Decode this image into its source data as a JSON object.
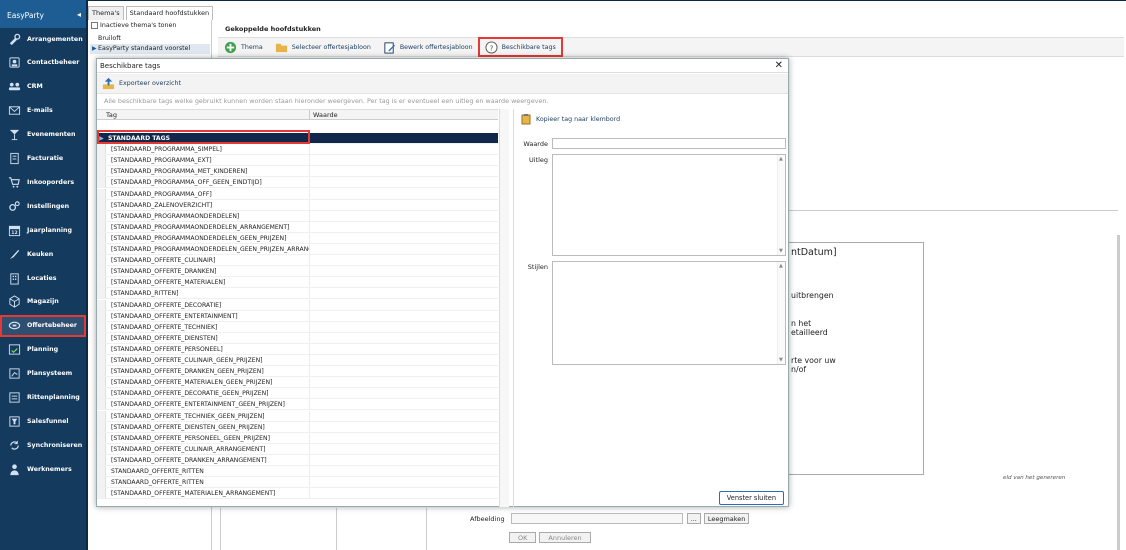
{
  "sidebar": {
    "brand": "EasyParty",
    "collapse_icon": "◂",
    "items": [
      {
        "label": "Arrangementen",
        "icon": "tools-icon"
      },
      {
        "label": "Contactbeheer",
        "icon": "contacts-icon"
      },
      {
        "label": "CRM",
        "icon": "crm-icon"
      },
      {
        "label": "E-mails",
        "icon": "mail-icon"
      },
      {
        "label": "Evenementen",
        "icon": "cocktail-icon"
      },
      {
        "label": "Facturatie",
        "icon": "invoice-icon"
      },
      {
        "label": "Inkooporders",
        "icon": "cart-icon"
      },
      {
        "label": "Instellingen",
        "icon": "gears-icon"
      },
      {
        "label": "Jaarplanning",
        "icon": "calendar-icon"
      },
      {
        "label": "Keuken",
        "icon": "knife-icon"
      },
      {
        "label": "Locaties",
        "icon": "building-icon"
      },
      {
        "label": "Magazijn",
        "icon": "box-icon"
      },
      {
        "label": "Offertebeheer",
        "icon": "quote-icon"
      },
      {
        "label": "Planning",
        "icon": "planning-icon"
      },
      {
        "label": "Plansysteem",
        "icon": "plansystem-icon"
      },
      {
        "label": "Rittenplanning",
        "icon": "routes-icon"
      },
      {
        "label": "Salesfunnel",
        "icon": "funnel-icon"
      },
      {
        "label": "Synchroniseren",
        "icon": "sync-icon"
      },
      {
        "label": "Werknemers",
        "icon": "person-icon"
      }
    ]
  },
  "app": {
    "tabs": [
      "Thema's",
      "Standaard hoofdstukken"
    ],
    "inactive_themes_label": "Inactieve thema's tonen",
    "themes": [
      "Bruiloft",
      "EasyParty standaard voorstel"
    ],
    "linked_chapters_title": "Gekoppelde hoofdstukken",
    "toolbar": {
      "theme": "Thema",
      "select_template": "Selecteer offertesjabloon",
      "edit_template": "Bewerk offertesjabloon",
      "available_tags": "Beschikbare tags"
    },
    "doc_snippets": [
      "ntDatum]",
      "uitbrengen",
      "n het",
      "etailleerd",
      "rte voor uw",
      "n/of"
    ],
    "doc_caption": "eld van het genereren",
    "image_label": "Afbeelding",
    "browse_button": "...",
    "clear_button": "Leegmaken",
    "ok_button": "OK",
    "cancel_button": "Annuleren"
  },
  "dialog": {
    "title": "Beschikbare tags",
    "close": "✕",
    "export_label": "Exporteer overzicht",
    "info_text": "Alle beschikbare tags welke gebruikt kunnen worden staan hieronder weergeven. Per tag is er eventueel een uitleg en waarde weergeven.",
    "columns": [
      "Tag",
      "Waarde"
    ],
    "group_label": "STANDAARD TAGS",
    "tags": [
      "[STANDAARD_PROGRAMMA_SIMPEL]",
      "[STANDAARD_PROGRAMMA_EXT]",
      "[STANDAARD_PROGRAMMA_MET_KINDEREN]",
      "[STANDAARD_PROGRAMMA_OFF_GEEN_EINDTIJD]",
      "[STANDAARD_PROGRAMMA_OFF]",
      "[STANDAARD_ZALENOVERZICHT]",
      "[STANDAARD_PROGRAMMAONDERDELEN]",
      "[STANDAARD_PROGRAMMAONDERDELEN_ARRANGEMENT]",
      "[STANDAARD_PROGRAMMAONDERDELEN_GEEN_PRIJZEN]",
      "[STANDAARD_PROGRAMMAONDERDELEN_GEEN_PRIJZEN_ARRANG",
      "[STANDAARD_OFFERTE_CULINAIR]",
      "[STANDAARD_OFFERTE_DRANKEN]",
      "[STANDAARD_OFFERTE_MATERIALEN]",
      "[STANDAARD_RITTEN]",
      "[STANDAARD_OFFERTE_DECORATIE]",
      "[STANDAARD_OFFERTE_ENTERTAINMENT]",
      "[STANDAARD_OFFERTE_TECHNIEK]",
      "[STANDAARD_OFFERTE_DIENSTEN]",
      "[STANDAARD_OFFERTE_PERSONEEL]",
      "[STANDAARD_OFFERTE_CULINAIR_GEEN_PRIJZEN]",
      "[STANDAARD_OFFERTE_DRANKEN_GEEN_PRIJZEN]",
      "[STANDAARD_OFFERTE_MATERIALEN_GEEN_PRIJZEN]",
      "[STANDAARD_OFFERTE_DECORATIE_GEEN_PRIJZEN]",
      "[STANDAARD_OFFERTE_ENTERTAINMENT_GEEN_PRIJZEN]",
      "[STANDAARD_OFFERTE_TECHNIEK_GEEN_PRIJZEN]",
      "[STANDAARD_OFFERTE_DIENSTEN_GEEN_PRIJZEN]",
      "[STANDAARD_OFFERTE_PERSONEEL_GEEN_PRIJZEN]",
      "[STANDAARD_OFFERTE_CULINAIR_ARRANGEMENT]",
      "[STANDAARD_OFFERTE_DRANKEN_ARRANGEMENT]",
      "STANDAARD_OFFERTE_RITTEN",
      "STANDAARD_OFFERTE_RITTEN",
      "[STANDAARD_OFFERTE_MATERIALEN_ARRANGEMENT]"
    ],
    "copy_label": "Kopieer tag naar klembord",
    "field_value": "Waarde",
    "field_explanation": "Uitleg",
    "field_styles": "Stijlen",
    "close_button": "Venster sluiten"
  },
  "colors": {
    "sidebar_bg": "#143a5e",
    "brand_bg": "#1d5d93",
    "highlight": "#e53935",
    "group_row": "#12284a"
  }
}
